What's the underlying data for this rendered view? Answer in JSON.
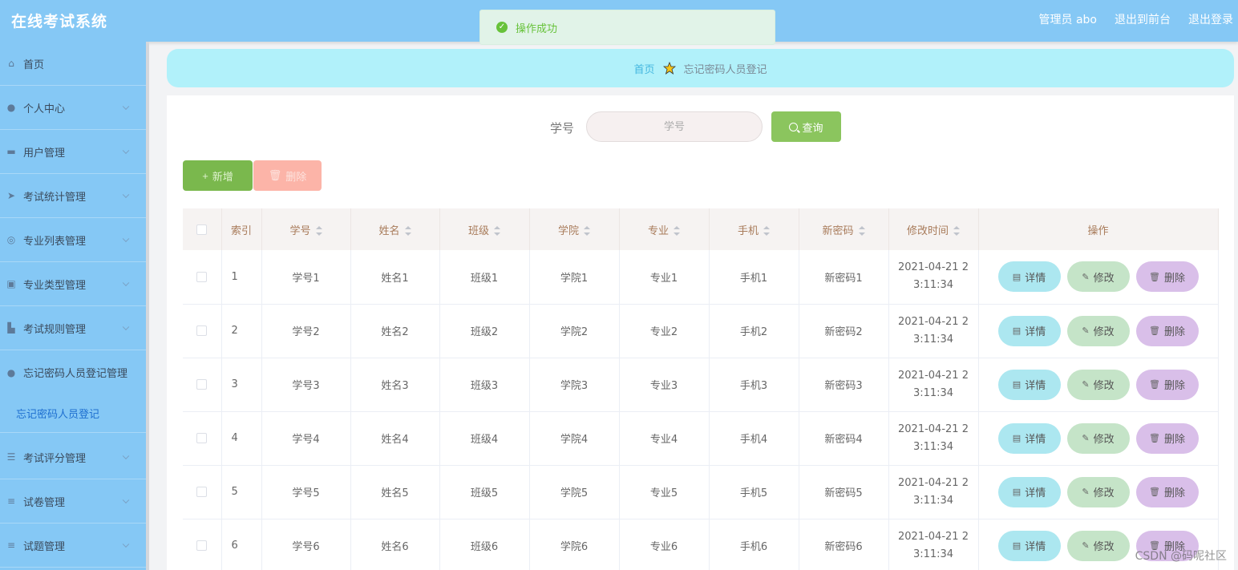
{
  "header": {
    "app_title": "在线考试系统",
    "links": [
      "管理员 abo",
      "退出到前台",
      "退出登录"
    ]
  },
  "toast": {
    "text": "操作成功"
  },
  "sidebar": {
    "items": [
      {
        "label": "首页",
        "icon": "home-icon"
      },
      {
        "label": "个人中心",
        "icon": "user-icon"
      },
      {
        "label": "用户管理",
        "icon": "users-icon"
      },
      {
        "label": "考试统计管理",
        "icon": "send-icon"
      },
      {
        "label": "专业列表管理",
        "icon": "target-icon"
      },
      {
        "label": "专业类型管理",
        "icon": "clipboard-icon"
      },
      {
        "label": "考试规则管理",
        "icon": "rule-icon"
      },
      {
        "label": "忘记密码人员登记管理",
        "icon": "person-icon"
      },
      {
        "label": "考试评分管理",
        "icon": "sliders-icon"
      },
      {
        "label": "试卷管理",
        "icon": "list-icon"
      },
      {
        "label": "试题管理",
        "icon": "list-icon"
      }
    ],
    "active_sub": "忘记密码人员登记"
  },
  "breadcrumb": {
    "home": "首页",
    "current": "忘记密码人员登记"
  },
  "search": {
    "label": "学号",
    "placeholder": "学号",
    "button": "查询"
  },
  "actions": {
    "add": "新增",
    "delete": "删除"
  },
  "table": {
    "headers": [
      "索引",
      "学号",
      "姓名",
      "班级",
      "学院",
      "专业",
      "手机",
      "新密码",
      "修改时间",
      "操作"
    ],
    "rows": [
      {
        "idx": "1",
        "sid": "学号1",
        "name": "姓名1",
        "cls": "班级1",
        "college": "学院1",
        "major": "专业1",
        "phone": "手机1",
        "pwd": "新密码1",
        "time": "2021-04-21 2\n3:11:34"
      },
      {
        "idx": "2",
        "sid": "学号2",
        "name": "姓名2",
        "cls": "班级2",
        "college": "学院2",
        "major": "专业2",
        "phone": "手机2",
        "pwd": "新密码2",
        "time": "2021-04-21 2\n3:11:34"
      },
      {
        "idx": "3",
        "sid": "学号3",
        "name": "姓名3",
        "cls": "班级3",
        "college": "学院3",
        "major": "专业3",
        "phone": "手机3",
        "pwd": "新密码3",
        "time": "2021-04-21 2\n3:11:34"
      },
      {
        "idx": "4",
        "sid": "学号4",
        "name": "姓名4",
        "cls": "班级4",
        "college": "学院4",
        "major": "专业4",
        "phone": "手机4",
        "pwd": "新密码4",
        "time": "2021-04-21 2\n3:11:34"
      },
      {
        "idx": "5",
        "sid": "学号5",
        "name": "姓名5",
        "cls": "班级5",
        "college": "学院5",
        "major": "专业5",
        "phone": "手机5",
        "pwd": "新密码5",
        "time": "2021-04-21 2\n3:11:34"
      },
      {
        "idx": "6",
        "sid": "学号6",
        "name": "姓名6",
        "cls": "班级6",
        "college": "学院6",
        "major": "专业6",
        "phone": "手机6",
        "pwd": "新密码6",
        "time": "2021-04-21 2\n3:11:34"
      }
    ],
    "row_actions": {
      "detail": "详情",
      "edit": "修改",
      "delete": "删除"
    }
  },
  "watermark": "CSDN @码呢社区",
  "colors": {
    "header_bg": "#85c8f5",
    "breadcrumb_bg": "#b1f1fa",
    "search_btn": "#8bc55e",
    "add_btn": "#7ab84d",
    "delete_btn": "#fcb4a8",
    "detail_btn": "#ace7f0",
    "edit_btn": "#c5e4c8",
    "row_delete_btn": "#d9bfe9"
  }
}
